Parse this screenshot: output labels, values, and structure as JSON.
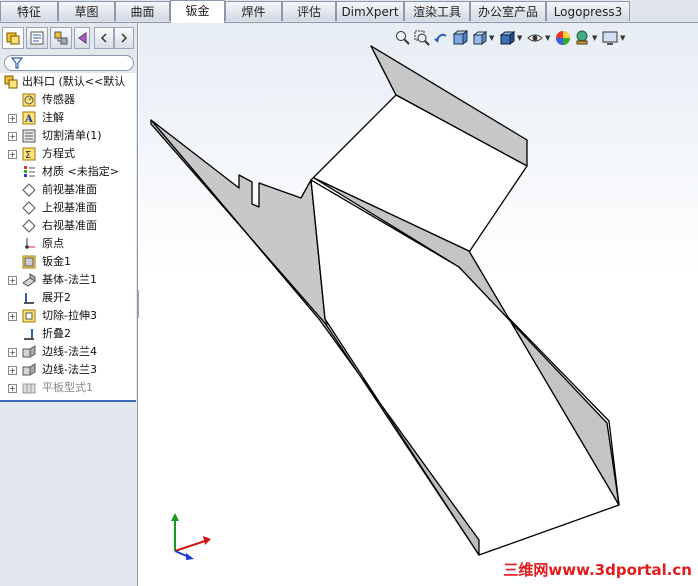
{
  "tabs": [
    "特征",
    "草图",
    "曲面",
    "钣金",
    "焊件",
    "评估",
    "DimXpert",
    "渲染工具",
    "办公室产品",
    "Logopress3"
  ],
  "active_tab": "钣金",
  "feature_tree": {
    "root": "出料口 (默认<<默认",
    "items": [
      {
        "label": "传感器",
        "expandable": false,
        "icon": "sensor-icon"
      },
      {
        "label": "注解",
        "expandable": true,
        "icon": "annotation-icon"
      },
      {
        "label": "切割清单(1)",
        "expandable": true,
        "icon": "cut-list-icon"
      },
      {
        "label": "方程式",
        "expandable": true,
        "icon": "equation-icon"
      },
      {
        "label": "材质 <未指定>",
        "expandable": false,
        "icon": "material-icon"
      },
      {
        "label": "前视基准面",
        "expandable": false,
        "icon": "plane-icon"
      },
      {
        "label": "上视基准面",
        "expandable": false,
        "icon": "plane-icon"
      },
      {
        "label": "右视基准面",
        "expandable": false,
        "icon": "plane-icon"
      },
      {
        "label": "原点",
        "expandable": false,
        "icon": "origin-icon"
      },
      {
        "label": "钣金1",
        "expandable": false,
        "icon": "sheet-metal-icon"
      },
      {
        "label": "基体-法兰1",
        "expandable": true,
        "icon": "base-flange-icon"
      },
      {
        "label": "展开2",
        "expandable": false,
        "icon": "unfold-icon"
      },
      {
        "label": "切除-拉伸3",
        "expandable": true,
        "icon": "cut-extrude-icon"
      },
      {
        "label": "折叠2",
        "expandable": false,
        "icon": "fold-icon"
      },
      {
        "label": "边线-法兰4",
        "expandable": true,
        "icon": "edge-flange-icon"
      },
      {
        "label": "边线-法兰3",
        "expandable": true,
        "icon": "edge-flange-icon"
      },
      {
        "label": "平板型式1",
        "expandable": true,
        "icon": "flat-pattern-icon",
        "suppressed": true
      }
    ]
  },
  "watermark": "三维网www.3dportal.cn",
  "colors": {
    "accent": "#3b6ab5",
    "watermark": "#e21b1b"
  }
}
